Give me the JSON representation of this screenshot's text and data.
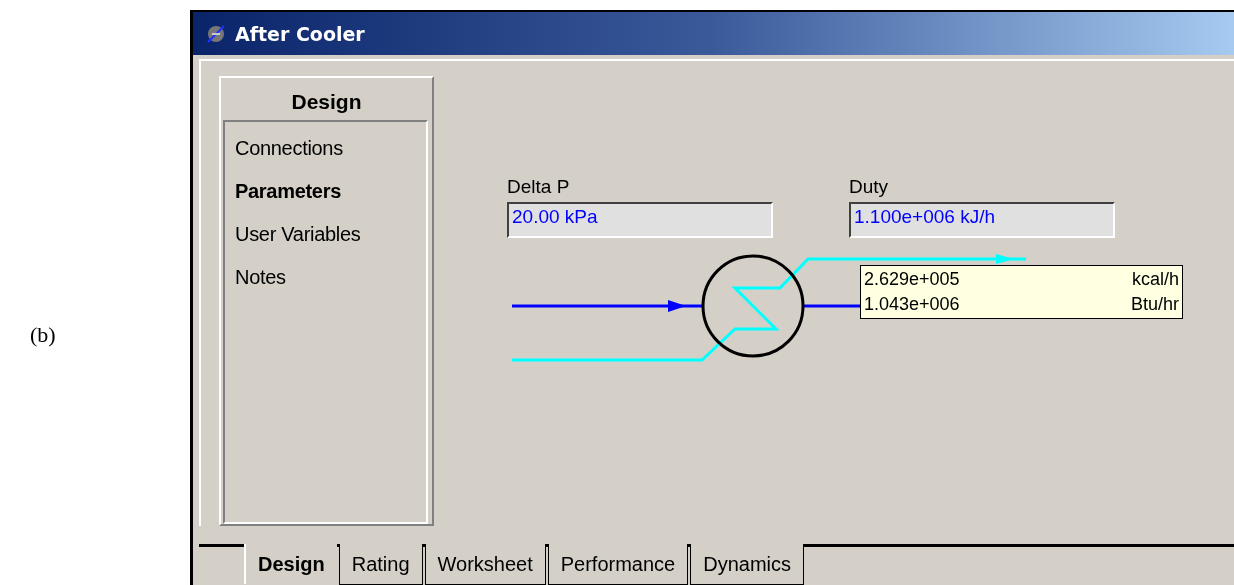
{
  "figure_label": "(b)",
  "window": {
    "title": "After Cooler"
  },
  "sidebar": {
    "header": "Design",
    "items": [
      {
        "label": "Connections",
        "selected": false
      },
      {
        "label": "Parameters",
        "selected": true
      },
      {
        "label": "User Variables",
        "selected": false
      },
      {
        "label": "Notes",
        "selected": false
      }
    ]
  },
  "fields": [
    {
      "label": "Delta P",
      "value": "20.00 kPa"
    },
    {
      "label": "Duty",
      "value": "1.100e+006 kJ/h"
    }
  ],
  "tooltip": {
    "rows": [
      {
        "value": "2.629e+005",
        "unit": "kcal/h"
      },
      {
        "value": "1.043e+006",
        "unit": "Btu/hr"
      }
    ]
  },
  "tabs": [
    {
      "label": "Design",
      "selected": true
    },
    {
      "label": "Rating",
      "selected": false
    },
    {
      "label": "Worksheet",
      "selected": false
    },
    {
      "label": "Performance",
      "selected": false
    },
    {
      "label": "Dynamics",
      "selected": false
    }
  ]
}
